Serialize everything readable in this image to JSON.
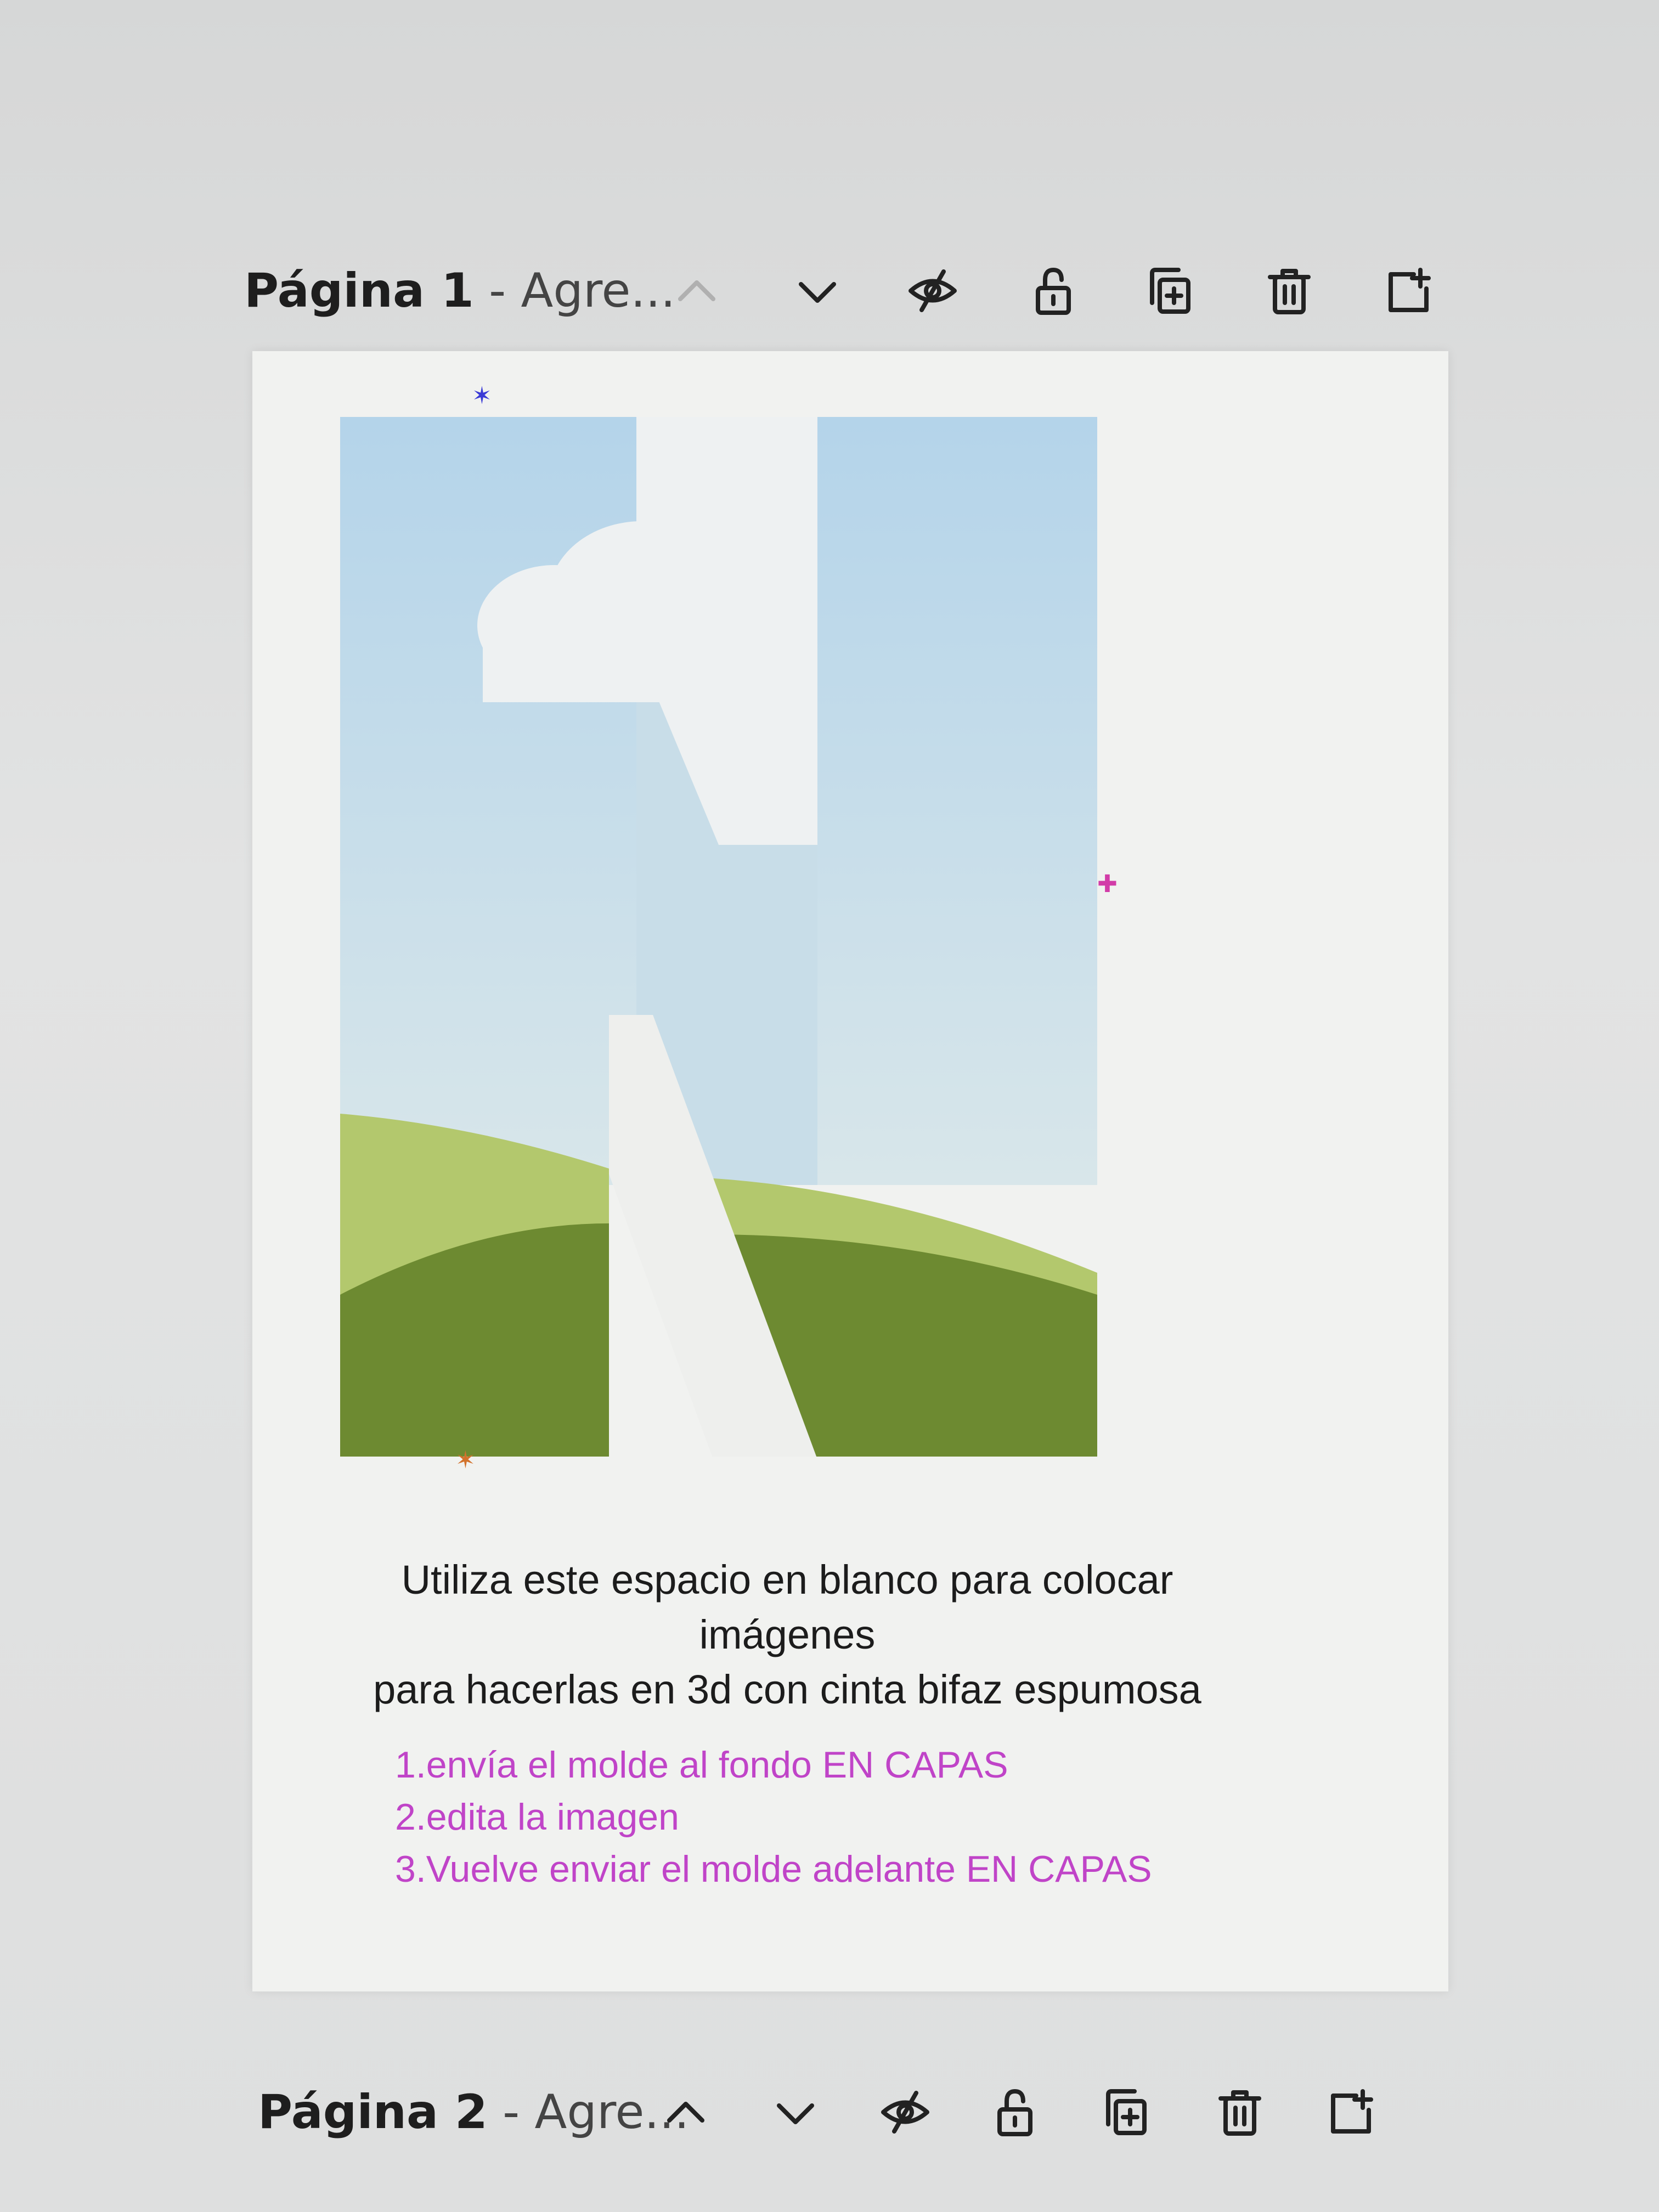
{
  "pages": [
    {
      "title": "Página 1",
      "subtitle": " - Agre..."
    },
    {
      "title": "Página 2",
      "subtitle": " - Agre..."
    }
  ],
  "canvas": {
    "caption_line1": "Utiliza este espacio en blanco para colocar imágenes",
    "caption_line2": "para hacerlas en 3d con cinta bifaz espumosa",
    "steps": [
      "1.envía el molde al fondo EN CAPAS",
      "2.edita la imagen",
      "3.Vuelve enviar el molde adelante EN CAPAS"
    ]
  },
  "icons": [
    "chevron-up-icon",
    "chevron-down-icon",
    "hide-eye-icon",
    "lock-icon",
    "duplicate-page-icon",
    "trash-icon",
    "add-page-icon"
  ],
  "colors": {
    "sky": "#b9d7ea",
    "grass_light": "#b4c96d",
    "grass_dark": "#6f8d32",
    "steps_text": "#c044c8",
    "page_bg": "#f1f2f0"
  }
}
